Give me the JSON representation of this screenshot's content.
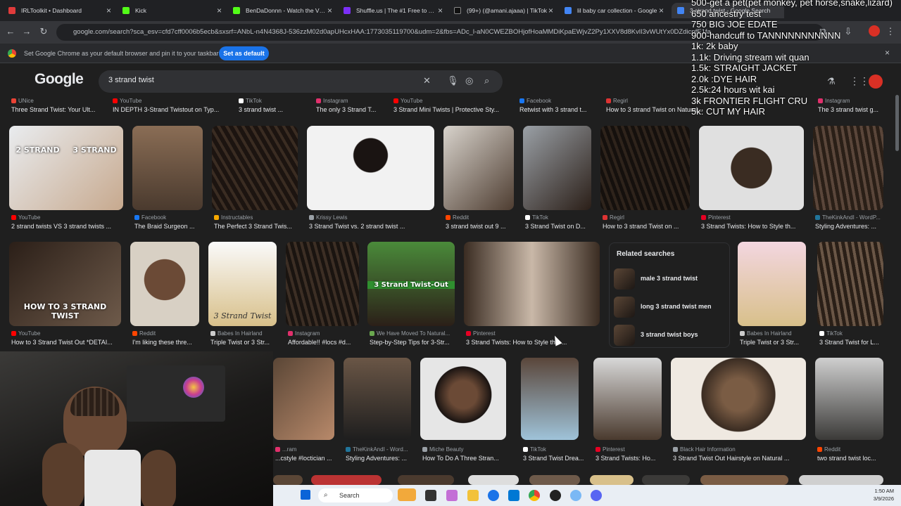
{
  "tabs": [
    {
      "title": "IRLToolkit • Dashboard",
      "fav": "#e03b3b"
    },
    {
      "title": "Kick",
      "fav": "#53fc18"
    },
    {
      "title": "BenDaDonnn - Watch the VOD",
      "fav": "#53fc18"
    },
    {
      "title": "Shuffle.us | The #1 Free to Play",
      "fav": "#7b2ff7"
    },
    {
      "title": "(99+) (@amani.ajaaa) | TikTok",
      "fav": "#111111"
    },
    {
      "title": "lil baby car collection - Google",
      "fav": "#4285f4"
    },
    {
      "title": "3 strand twist - Google Search",
      "fav": "#4285f4"
    }
  ],
  "address": {
    "url": "google.com/search?sca_esv=cfd7cff0006b5ecb&sxsrf=ANbL-n4N4368J-536zzM02d0apUHcxHAA:1773035119700&udm=2&fbs=ADc_l-aN0CWEZBOHjofHoaMMDiKpaEWjvZ2Py1XXV8d8KvlI3vWUtYx0DZdicpfE1fa"
  },
  "infobar": {
    "text": "Set Google Chrome as your default browser and pin it to your taskbar",
    "button": "Set as default"
  },
  "google": {
    "logo": "Google",
    "query": "3 strand twist"
  },
  "row0": [
    {
      "src": "UNice",
      "title": "Three Strand Twist: Your Ult...",
      "c": "#ea4335"
    },
    {
      "src": "YouTube",
      "title": "IN DEPTH 3-Strand Twistout on Typ...",
      "c": "#ff0000"
    },
    {
      "src": "TikTok",
      "title": "3 strand twist ...",
      "c": "#ffffff"
    },
    {
      "src": "Instagram",
      "title": "The only 3 Strand T...",
      "c": "#e1306c"
    },
    {
      "src": "YouTube",
      "title": "3 Strand Mini Twists | Protective Sty...",
      "c": "#ff0000"
    },
    {
      "src": "Facebook",
      "title": "Retwist with 3 strand t...",
      "c": "#1877f2"
    },
    {
      "src": "Regirl",
      "title": "How to 3 strand Twist on Natural...",
      "c": "#d33"
    },
    {
      "src": "Instagram",
      "title": "The 3 strand twist g...",
      "c": "#e1306c"
    }
  ],
  "row1": [
    {
      "src": "YouTube",
      "title": "2 strand twists VS 3 strand twists ...",
      "c": "#ff0000",
      "ov1": "2 STRAND",
      "ov2": "3 STRAND"
    },
    {
      "src": "Facebook",
      "title": "The Braid Surgeon ...",
      "c": "#1877f2"
    },
    {
      "src": "Instructables",
      "title": "The Perfect 3 Strand Twis...",
      "c": "#f6a800"
    },
    {
      "src": "Krissy Lewis",
      "title": "3 Strand Twist vs. 2 strand twist ...",
      "c": "#9aa0a6"
    },
    {
      "src": "Reddit",
      "title": "3 strand twist out 9 ...",
      "c": "#ff4500"
    },
    {
      "src": "TikTok",
      "title": "3 Strand Twist on D...",
      "c": "#ffffff"
    },
    {
      "src": "Regirl",
      "title": "How to 3 strand Twist on ...",
      "c": "#d33"
    },
    {
      "src": "Pinterest",
      "title": "3 Strand Twists: How to Style th...",
      "c": "#e60023"
    },
    {
      "src": "TheKinkAndI - WordP...",
      "title": "Styling Adventures: ...",
      "c": "#21759b"
    }
  ],
  "row2": [
    {
      "src": "YouTube",
      "title": "How to 3 Strand Twist Out *DETAI...",
      "c": "#ff0000",
      "ov": "HOW TO 3 STRAND TWIST"
    },
    {
      "src": "Reddit",
      "title": "I'm liking these thre...",
      "c": "#ff4500"
    },
    {
      "src": "Babes In Hairland",
      "title": "Triple Twist or 3 Str...",
      "c": "#cccccc",
      "ov": "3 Strand Twist"
    },
    {
      "src": "Instagram",
      "title": "Affordable!! #locs #d...",
      "c": "#e1306c"
    },
    {
      "src": "We Have Moved To Natural...",
      "title": "Step-by-Step Tips for 3-Str...",
      "c": "#6aa84f",
      "ov": "3 Strand Twist-Out"
    },
    {
      "src": "Pinterest",
      "title": "3 Strand Twists: How to Style this ...",
      "c": "#e60023"
    },
    {
      "src": "Babes In Hairland",
      "title": "Triple Twist or 3 Str...",
      "c": "#cccccc"
    },
    {
      "src": "TikTok",
      "title": "3 Strand Twist for L...",
      "c": "#ffffff"
    }
  ],
  "row3": [
    {
      "src": "...ram",
      "title": "...cstyle #loctician ...",
      "c": "#e1306c"
    },
    {
      "src": "TheKinkAndI - Word...",
      "title": "Styling Adventures: ...",
      "c": "#21759b"
    },
    {
      "src": "Miche Beauty",
      "title": "How To Do A Three Stran...",
      "c": "#9aa0a6"
    },
    {
      "src": "TikTok",
      "title": "3 Strand Twist Drea...",
      "c": "#ffffff"
    },
    {
      "src": "Pinterest",
      "title": "3 Strand Twists: Ho...",
      "c": "#e60023"
    },
    {
      "src": "Black Hair Information",
      "title": "3 Strand Twist Out Hairstyle on Natural ...",
      "c": "#9aa0a6"
    },
    {
      "src": "Reddit",
      "title": "two strand twist loc...",
      "c": "#ff4500"
    }
  ],
  "related": {
    "heading": "Related searches",
    "items": [
      "male 3 strand twist",
      "long 3 strand twist men",
      "3 strand twist boys"
    ]
  },
  "overlay": [
    "500-get a pet(pet monkey, pet horse,snake,lizard)",
    "650 ancestry test",
    "750 BIG JOE EDATE",
    "900-handcuff to TANNNNNNNNNNN",
    "1k: 2k baby",
    "1.1k: Driving stream wit quan",
    "1.5k: STRAIGHT JACKET",
    "2.0k :DYE HAIR",
    "2.5k:24 hours wit kai",
    "3k FRONTIER FLIGHT CRU",
    "5k: CUT MY HAIR"
  ],
  "taskbar": {
    "search": "Search",
    "time": "1:50 AM",
    "date": "3/9/2026"
  }
}
